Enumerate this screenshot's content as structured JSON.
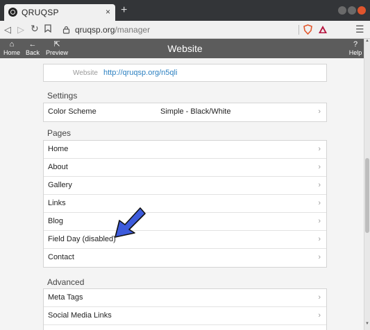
{
  "browser": {
    "tab_title": "QRUQSP",
    "tab_close": "×",
    "new_tab": "+",
    "url_host": "qruqsp.org",
    "url_path": "/manager"
  },
  "appbar": {
    "home_label": "Home",
    "back_label": "Back",
    "preview_label": "Preview",
    "help_label": "Help",
    "title": "Website"
  },
  "website": {
    "label": "Website",
    "url": "http://qruqsp.org/n5qli"
  },
  "settings": {
    "title": "Settings",
    "items": [
      {
        "label": "Color Scheme",
        "value": "Simple - Black/White"
      }
    ]
  },
  "pages": {
    "title": "Pages",
    "items": [
      {
        "label": "Home"
      },
      {
        "label": "About"
      },
      {
        "label": "Gallery"
      },
      {
        "label": "Links"
      },
      {
        "label": "Blog"
      },
      {
        "label": "Field Day (disabled)"
      },
      {
        "label": "Contact"
      }
    ]
  },
  "advanced": {
    "title": "Advanced",
    "items": [
      {
        "label": "Meta Tags"
      },
      {
        "label": "Social Media Links"
      },
      {
        "label": ""
      }
    ]
  },
  "icons": {
    "chevron": "›",
    "help": "?"
  },
  "colors": {
    "appbar": "#5c5c5c",
    "link": "#2a7fc0",
    "arrow": "#3d5bdc"
  }
}
